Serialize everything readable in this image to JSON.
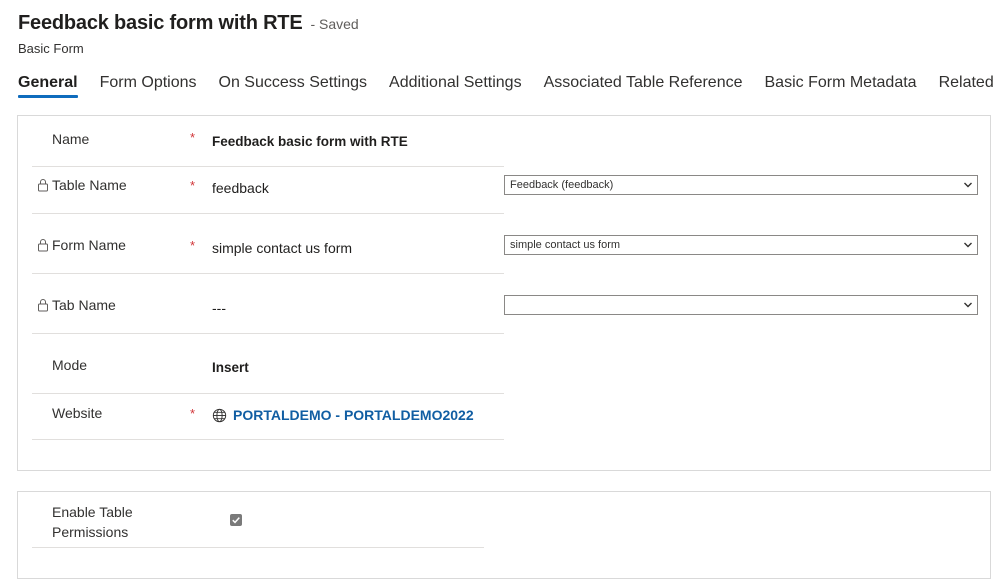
{
  "header": {
    "title": "Feedback basic form with RTE",
    "status": "- Saved",
    "entity_type": "Basic Form"
  },
  "tabs": [
    {
      "label": "General",
      "active": true
    },
    {
      "label": "Form Options"
    },
    {
      "label": "On Success Settings"
    },
    {
      "label": "Additional Settings"
    },
    {
      "label": "Associated Table Reference"
    },
    {
      "label": "Basic Form Metadata"
    },
    {
      "label": "Related"
    }
  ],
  "general": {
    "name": {
      "label": "Name",
      "required": "*",
      "value": "Feedback basic form with RTE"
    },
    "table_name": {
      "label": "Table Name",
      "required": "*",
      "value": "feedback",
      "select_value": "Feedback (feedback)"
    },
    "form_name": {
      "label": "Form Name",
      "required": "*",
      "value": "simple contact us form",
      "select_value": "simple contact us form"
    },
    "tab_name": {
      "label": "Tab Name",
      "value": "---",
      "select_value": ""
    },
    "mode": {
      "label": "Mode",
      "value": "Insert"
    },
    "website": {
      "label": "Website",
      "required": "*",
      "value": "PORTALDEMO - PORTALDEMO2022"
    }
  },
  "permissions": {
    "label_line1": "Enable Table",
    "label_line2": "Permissions",
    "checked": true
  },
  "colors": {
    "accent": "#0f6cbd",
    "link": "#115ea3",
    "required": "#d13438"
  },
  "icons": [
    "lock-icon",
    "globe-icon",
    "chevron-down-icon",
    "checkmark-icon"
  ]
}
